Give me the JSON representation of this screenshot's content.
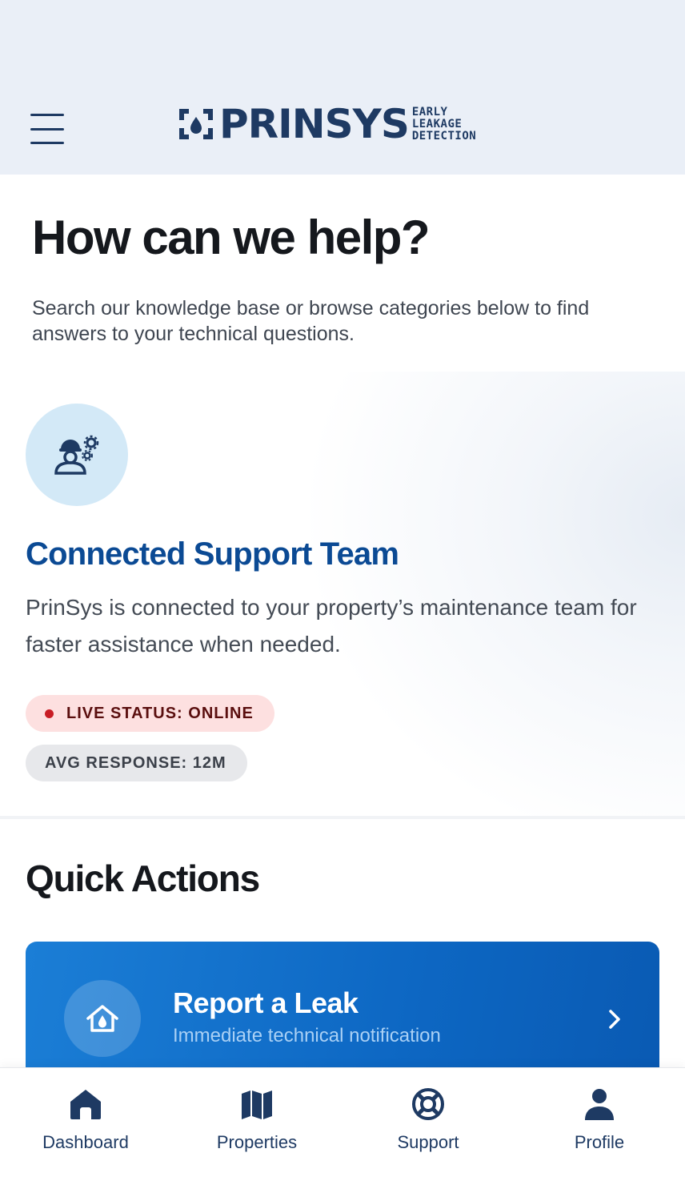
{
  "header": {
    "logo_word": "PRINSYS",
    "logo_tagline": [
      "EARLY",
      "LEAKAGE",
      "DETECTION"
    ],
    "menu_icon": "hamburger-menu-icon"
  },
  "help": {
    "title": "How can we help?",
    "subtitle": "Search our knowledge base or browse categories below to find answers to your technical questions."
  },
  "support": {
    "icon": "support-engineer-icon",
    "title": "Connected Support Team",
    "description": "PrinSys is connected to your property’s maintenance team for faster assistance when needed.",
    "live_status": "LIVE STATUS: ONLINE",
    "avg_response": "AVG RESPONSE: 12M"
  },
  "quick_actions": {
    "title": "Quick Actions",
    "report_leak": {
      "title": "Report a Leak",
      "subtitle": "Immediate technical notification",
      "icon": "house-droplet-icon"
    }
  },
  "nav": {
    "items": [
      {
        "label": "Dashboard",
        "icon": "home-icon"
      },
      {
        "label": "Properties",
        "icon": "map-icon"
      },
      {
        "label": "Support",
        "icon": "lifebuoy-icon"
      },
      {
        "label": "Profile",
        "icon": "person-icon"
      }
    ]
  },
  "colors": {
    "brand_navy": "#1e3a63",
    "accent_blue": "#0b4a94",
    "live_dot": "#c81d25",
    "header_bg": "#eaeff7"
  }
}
